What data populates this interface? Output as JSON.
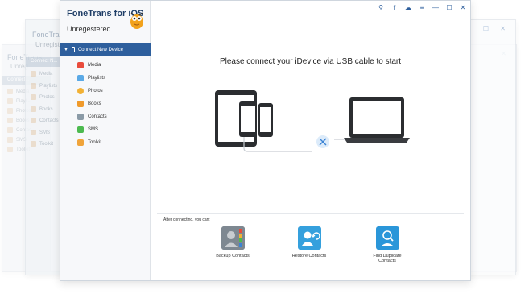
{
  "app": {
    "name": "FoneTrans for iOS",
    "status": "Unregestered"
  },
  "ghost_windows": [
    {
      "title": "FoneTrans",
      "sub": "Unreg",
      "items": [
        "Connect...",
        "Media",
        "Playli...",
        "Photos",
        "Books",
        "Contac...",
        "SMS",
        "Toolkit"
      ]
    },
    {
      "title": "FoneTrans",
      "sub": "Unregistered",
      "items": [
        "Connect N...",
        "Media",
        "Playlists",
        "Photos",
        "Books",
        "Contacts",
        "SMS",
        "Toolkit"
      ]
    }
  ],
  "sidebar": {
    "device": "Connect New Device",
    "items": [
      {
        "label": "Media",
        "color": "#e94b3c"
      },
      {
        "label": "Playlists",
        "color": "#5aa9e6"
      },
      {
        "label": "Photos",
        "color": "#f2b134"
      },
      {
        "label": "Books",
        "color": "#f09a2a"
      },
      {
        "label": "Contacts",
        "color": "#8a9aa6"
      },
      {
        "label": "SMS",
        "color": "#4cba4f"
      },
      {
        "label": "Toolkit",
        "color": "#f0a43a"
      }
    ]
  },
  "topbar": {
    "icons": [
      "key-icon",
      "facebook-icon",
      "chat-icon",
      "menu-icon",
      "minimize-icon",
      "maximize-icon",
      "close-icon"
    ],
    "glyphs": [
      "⚲",
      "f",
      "☁",
      "≡",
      "—",
      "☐",
      "✕"
    ]
  },
  "main": {
    "headline": "Please connect your iDevice via USB cable to start",
    "after_label": "After connecting, you can:",
    "actions": [
      "Backup Contacts",
      "Restore Contacts",
      "Find Duplicate Contacts"
    ]
  }
}
